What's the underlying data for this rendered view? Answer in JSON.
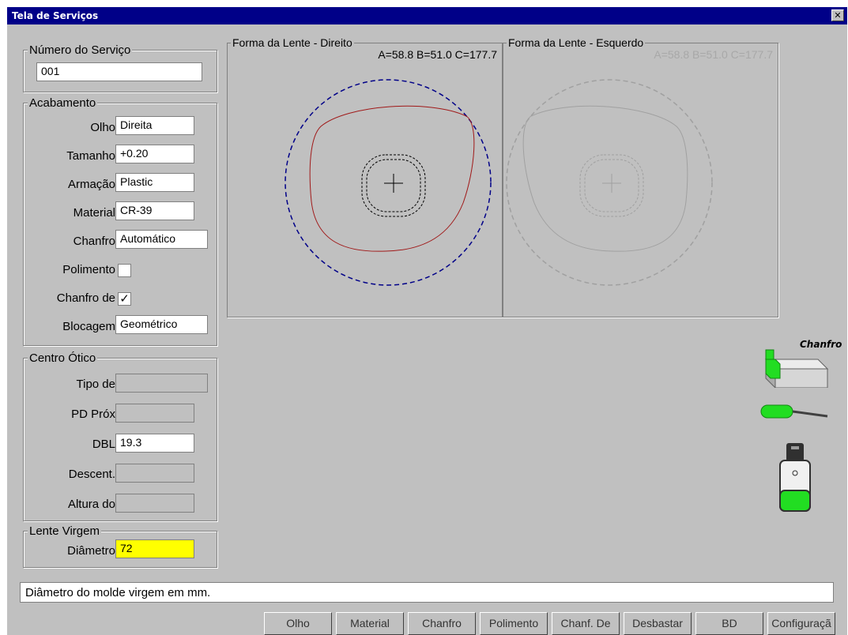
{
  "window": {
    "title": "Tela de Serviços",
    "close_glyph": "✕"
  },
  "service": {
    "legend": "Número do Serviço",
    "value": "001"
  },
  "acabamento": {
    "legend": "Acabamento",
    "olho": {
      "label": "Olho",
      "value": "Direita"
    },
    "tamanho": {
      "label": "Tamanho",
      "value": "+0.20"
    },
    "armacao": {
      "label": "Armação",
      "value": "Plastic"
    },
    "material": {
      "label": "Material",
      "value": "CR-39"
    },
    "chanfro": {
      "label": "Chanfro",
      "value": "Automático"
    },
    "polimento": {
      "label": "Polimento",
      "checked": false
    },
    "chanfro_de": {
      "label": "Chanfro de",
      "checked": true,
      "check_glyph": "✓"
    },
    "blocagem": {
      "label": "Blocagem",
      "value": "Geométrico"
    }
  },
  "centro_otico": {
    "legend": "Centro Ótico",
    "tipo": {
      "label": "Tipo de",
      "value": ""
    },
    "pd": {
      "label": "PD Próx",
      "value": ""
    },
    "dbl": {
      "label": "DBL",
      "value": "19.3"
    },
    "descent": {
      "label": "Descent.",
      "value": ""
    },
    "altura": {
      "label": "Altura do",
      "value": ""
    }
  },
  "lente_virgem": {
    "legend": "Lente Virgem",
    "diametro": {
      "label": "Diâmetro",
      "value": "72",
      "highlight": "#ffff00"
    }
  },
  "lens_right": {
    "title": "Forma da Lente - Direito",
    "dims": "A=58.8 B=51.0 C=177.7",
    "trace_color": "#a01818",
    "circle_color": "#000088"
  },
  "lens_left": {
    "title": "Forma da Lente - Esquerdo",
    "dims": "A=58.8 B=51.0 C=177.7",
    "trace_color": "#a0a0a0"
  },
  "tools": {
    "chanfro_label": "Chanfro",
    "icons": [
      "chanfro-tool-icon",
      "drill-bit-icon",
      "water-tank-icon"
    ]
  },
  "status_message": "Diâmetro do molde virgem em mm.",
  "toolbar": {
    "buttons": [
      "Olho",
      "Material",
      "Chanfro",
      "Polimento",
      "Chanf. De",
      "Desbastar",
      "BD",
      "Configuraçã"
    ]
  },
  "colors": {
    "window_bg": "#c0c0c0",
    "titlebar": "#000088",
    "accent_green": "#22dd22"
  }
}
